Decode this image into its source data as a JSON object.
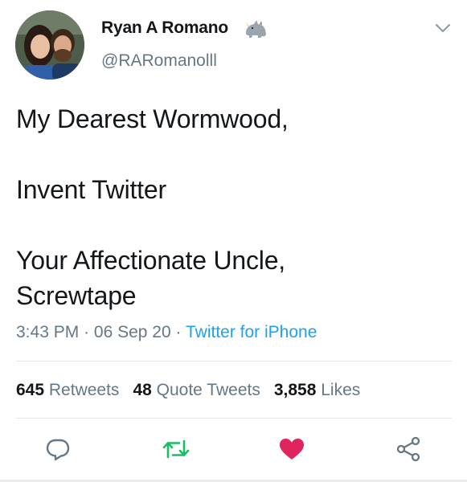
{
  "author": {
    "display_name": "Ryan A Romano",
    "handle": "@RARomanolll",
    "name_emoji": "rhinoceros-emoji",
    "avatar": "profile-photo-couple"
  },
  "tweet": {
    "lines": [
      "My Dearest Wormwood,",
      "Invent Twitter",
      "Your Affectionate Uncle,",
      "Screwtape"
    ],
    "time": "3:43 PM",
    "date": "06 Sep 20",
    "separator": "·",
    "source": "Twitter for iPhone"
  },
  "stats": {
    "retweets_count": "645",
    "retweets_label": "Retweets",
    "quote_count": "48",
    "quote_label": "Quote Tweets",
    "likes_count": "3,858",
    "likes_label": "Likes"
  },
  "actions": {
    "reply_icon": "reply-icon",
    "retweet_icon": "retweet-icon",
    "like_icon": "heart-icon",
    "share_icon": "share-icon"
  },
  "colors": {
    "text": "#14171a",
    "secondary": "#657786",
    "link": "#1da1f2",
    "retweet": "#17bf63",
    "like": "#e0245e",
    "divider": "#e1e8ed"
  }
}
